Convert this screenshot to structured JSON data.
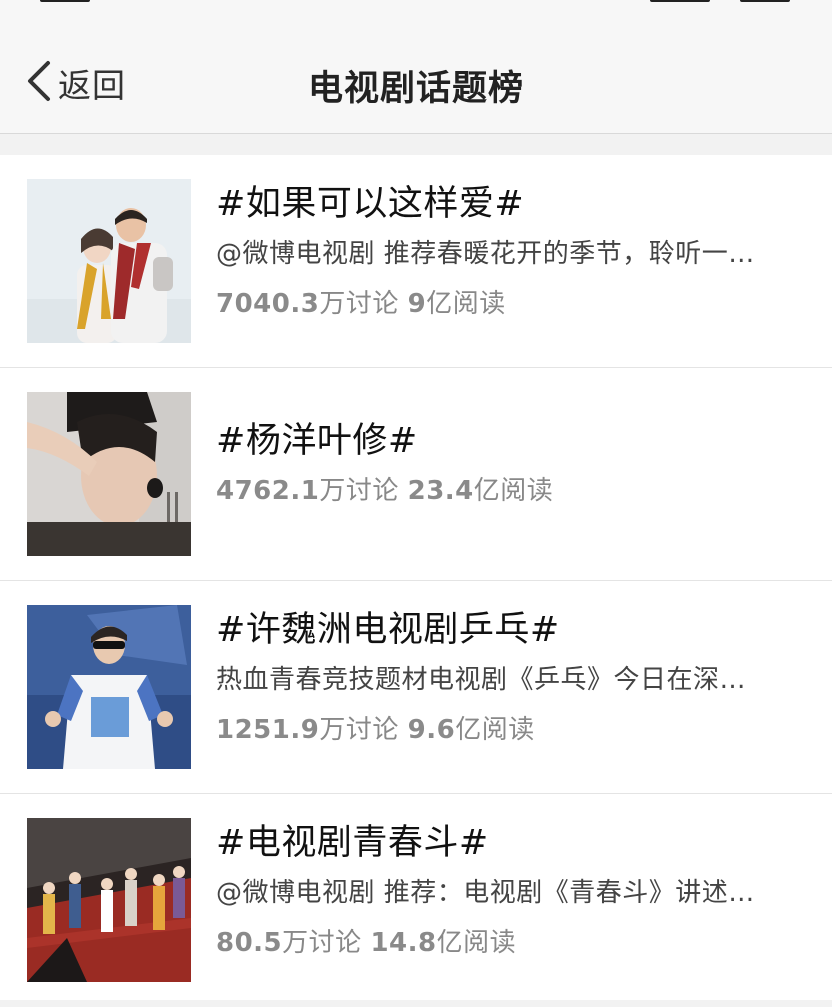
{
  "nav": {
    "back_label": "返回",
    "title": "电视剧话题榜"
  },
  "topics": [
    {
      "title": "#如果可以这样爱#",
      "desc": "@微博电视剧 推荐春暖花开的季节，聆听一…",
      "discuss_num": "7040.3",
      "discuss_label": "万讨论",
      "read_num": "9",
      "read_label": "亿阅读"
    },
    {
      "title": "#杨洋叶修#",
      "discuss_num": "4762.1",
      "discuss_label": "万讨论",
      "read_num": "23.4",
      "read_label": "亿阅读"
    },
    {
      "title": "#许魏洲电视剧乒乓#",
      "desc": "热血青春竞技题材电视剧《乒乓》今日在深…",
      "discuss_num": "1251.9",
      "discuss_label": "万讨论",
      "read_num": "9.6",
      "read_label": "亿阅读"
    },
    {
      "title": "#电视剧青春斗#",
      "desc": "@微博电视剧 推荐：电视剧《青春斗》讲述…",
      "discuss_num": "80.5",
      "discuss_label": "万讨论",
      "read_num": "14.8",
      "read_label": "亿阅读"
    }
  ]
}
